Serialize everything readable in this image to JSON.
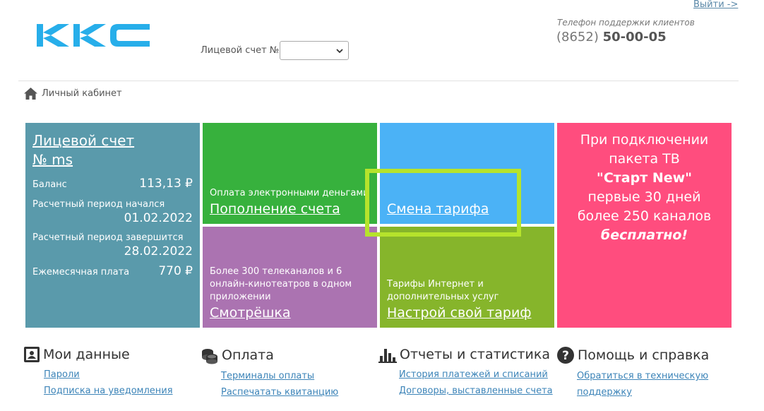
{
  "header": {
    "logo_text": "ККС",
    "logout_label": "Выйти ->",
    "account_label": "Лицевой счет №",
    "account_select_value": "",
    "support_label": "Телефон поддержки клиентов",
    "support_code": "(8652)",
    "support_number": "50-00-05"
  },
  "breadcrumb": {
    "label": "Личный кабинет"
  },
  "account_tile": {
    "title_line1": "Лицевой счет",
    "title_line2": "№ ms",
    "balance_label": "Баланс",
    "balance_value": "113,13 ₽",
    "period_start_label": "Расчетный период начался",
    "period_start_value": "01.02.2022",
    "period_end_label": "Расчетный период завершится",
    "period_end_value": "28.02.2022",
    "monthly_label": "Ежемесячная плата",
    "monthly_value": "770 ₽"
  },
  "tiles": {
    "pay": {
      "caption": "Оплата электронными деньгами",
      "link": "Пополнение счета",
      "color": "#37b13d"
    },
    "tariff": {
      "link": "Смена тарифа",
      "color": "#4bb2f6"
    },
    "tv": {
      "caption": "Более 300 телеканалов и 6 онлайн-кинотеатров в одном приложении",
      "link": "Смотрёшка",
      "color": "#ab73b1"
    },
    "custom": {
      "caption": "Тарифы Интернет и дополнительных услуг",
      "link": "Настрой свой тариф",
      "color": "#86b52b"
    }
  },
  "promo": {
    "line1": "При подключении",
    "line2": "пакета ТВ",
    "line3": "\"Старт New\"",
    "line4": "первые 30 дней",
    "line5": "более 250 каналов",
    "line6": "бесплатно!",
    "color": "#ff4d7e"
  },
  "highlight_color": "#b6e32c",
  "sections": [
    {
      "title": "Мои данные",
      "icon": "id-card-icon",
      "links": [
        "Пароли",
        "Подписка на уведомления"
      ]
    },
    {
      "title": "Оплата",
      "icon": "coins-icon",
      "links": [
        "Терминалы оплаты",
        "Распечатать квитанцию"
      ]
    },
    {
      "title": "Отчеты и статистика",
      "icon": "bar-chart-icon",
      "links": [
        "История платежей и списаний",
        "Договоры, выставленные счета"
      ]
    },
    {
      "title": "Помощь и справка",
      "icon": "help-icon",
      "links": [
        "Обратиться в техническую",
        "поддержку"
      ]
    }
  ]
}
